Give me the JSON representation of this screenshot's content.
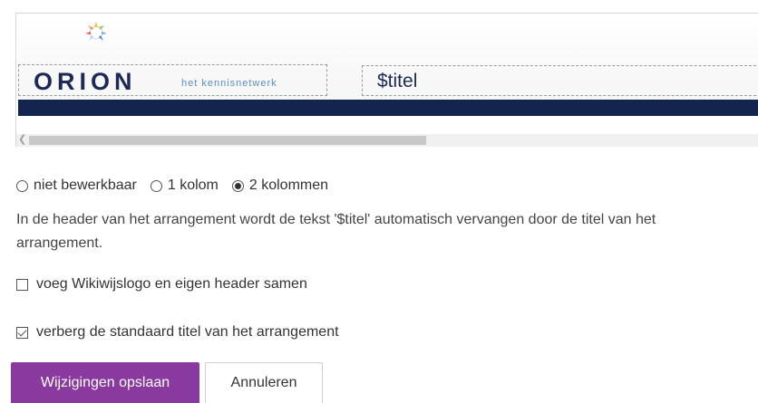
{
  "header_preview": {
    "logo_word": "ORION",
    "logo_tagline": "het kennisnetwerk",
    "title_placeholder": "$titel"
  },
  "layout_options": {
    "options": [
      {
        "label": "niet bewerkbaar",
        "selected": false
      },
      {
        "label": "1 kolom",
        "selected": false
      },
      {
        "label": "2 kolommen",
        "selected": true
      }
    ]
  },
  "info_text": "In de header van het arrangement wordt de tekst '$titel' automatisch vervangen door de titel van het arrangement.",
  "checkboxes": [
    {
      "label": "voeg Wikiwijslogo en eigen header samen",
      "checked": false
    },
    {
      "label": "verberg de standaard titel van het arrangement",
      "checked": true
    }
  ],
  "buttons": {
    "save_label": "Wijzigingen opslaan",
    "cancel_label": "Annuleren"
  },
  "colors": {
    "primary_button": "#8a3a9e",
    "header_bar": "#13254f",
    "logo_text": "#1c2a55",
    "tagline": "#5a8fc6"
  }
}
